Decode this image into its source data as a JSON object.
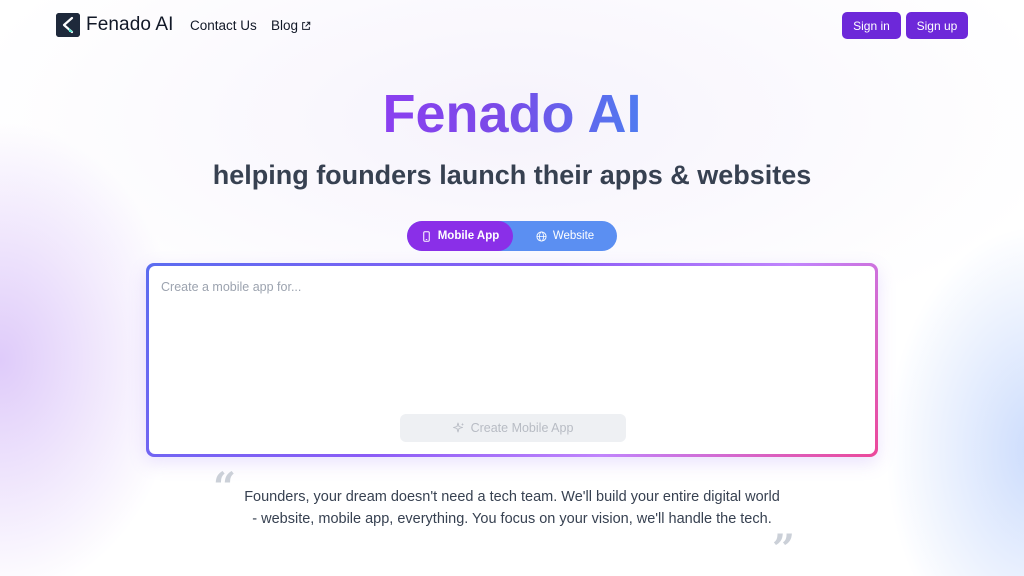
{
  "header": {
    "brand": "Fenado AI",
    "nav": {
      "contact_label": "Contact Us",
      "blog_label": "Blog"
    },
    "signin_label": "Sign in",
    "signup_label": "Sign up"
  },
  "hero": {
    "title": "Fenado AI",
    "subtitle": "helping founders launch their apps & websites"
  },
  "toggle": {
    "options": [
      {
        "label": "Mobile App",
        "icon": "smartphone-icon",
        "selected": true
      },
      {
        "label": "Website",
        "icon": "globe-icon",
        "selected": false
      }
    ]
  },
  "prompt": {
    "value": "",
    "placeholder": "Create a mobile app for...",
    "submit_label": "Create Mobile App",
    "submit_icon": "sparkles-icon"
  },
  "quote": {
    "text": "Founders, your dream doesn't need a tech team. We'll build your entire digital world - website, mobile app, everything. You focus on your vision, we'll handle the tech."
  },
  "colors": {
    "accent": "#6d28d9",
    "toggle_active": "#8a2fe8",
    "toggle_track": "#5b8ff2",
    "title_gradient_start": "#8b3ff0",
    "title_gradient_end": "#4f7cf0"
  }
}
